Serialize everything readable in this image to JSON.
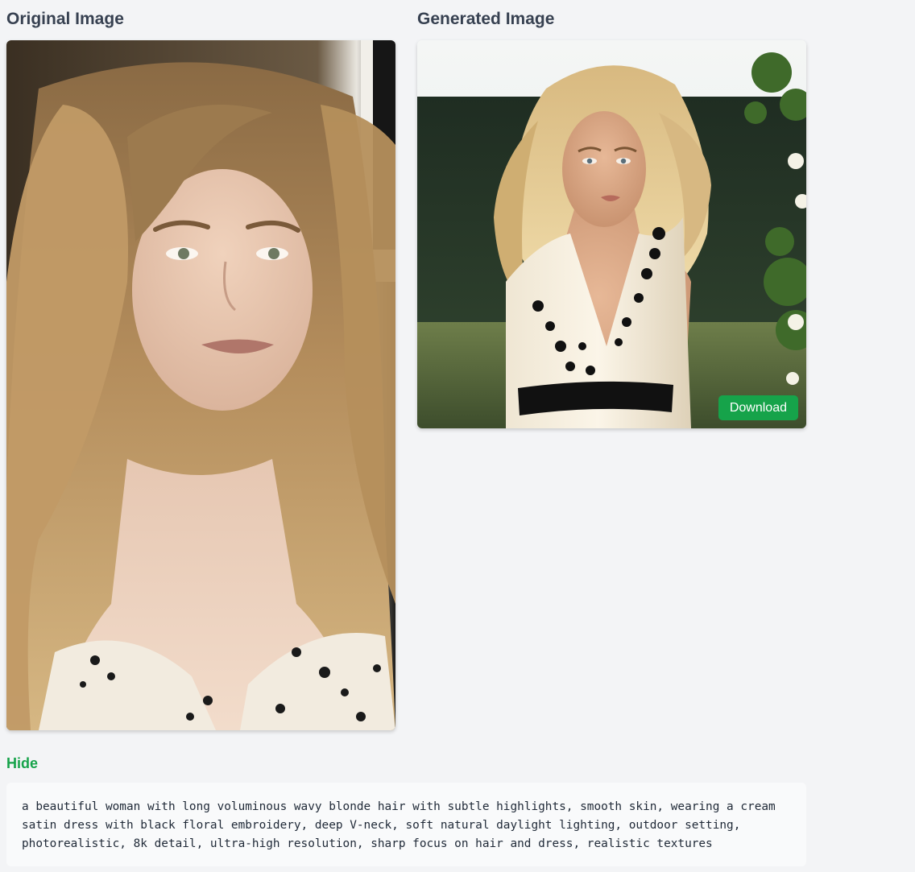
{
  "columns": {
    "original_title": "Original Image",
    "generated_title": "Generated Image"
  },
  "images": {
    "original_alt": "Original Image",
    "generated_alt": "Generated Image"
  },
  "actions": {
    "download_label": "Download",
    "toggle_label": "Hide"
  },
  "prompt": {
    "text": "a beautiful woman with long voluminous wavy blonde hair with subtle highlights, smooth skin, wearing a cream satin dress with black floral embroidery, deep V-neck, soft natural daylight lighting, outdoor setting, photorealistic, 8k detail, ultra-high resolution, sharp focus on hair and dress, realistic textures"
  },
  "colors": {
    "page_background": "#f3f4f6",
    "accent_green": "#16a34a",
    "heading_text": "#374151",
    "prompt_background": "#f9fafb"
  }
}
